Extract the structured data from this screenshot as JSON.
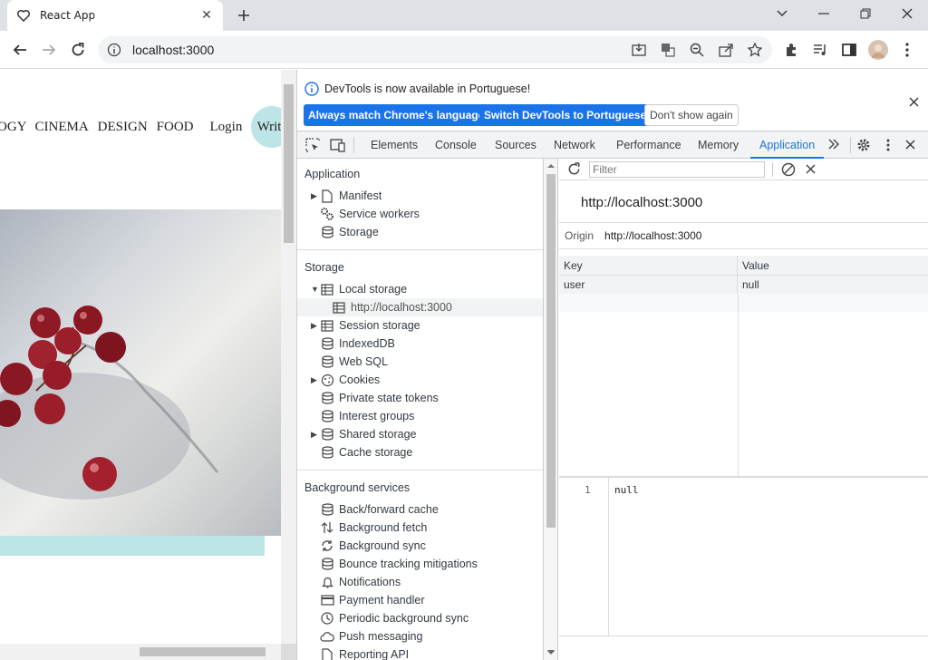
{
  "browser": {
    "tab_title": "React App",
    "url": "localhost:3000"
  },
  "page": {
    "nav_items": [
      "OGY",
      "CINEMA",
      "DESIGN",
      "FOOD"
    ],
    "login": "Login",
    "write": "Write",
    "accent_color": "#bde4e6"
  },
  "devtools": {
    "info_message": "DevTools is now available in Portuguese!",
    "btn_match": "Always match Chrome's language",
    "btn_switch": "Switch DevTools to Portuguese",
    "btn_dont_show": "Don't show again",
    "tabs": [
      "Elements",
      "Console",
      "Sources",
      "Network",
      "Performance",
      "Memory",
      "Application"
    ],
    "active_tab": "Application",
    "sidebar": {
      "application_header": "Application",
      "application_items": [
        "Manifest",
        "Service workers",
        "Storage"
      ],
      "storage_header": "Storage",
      "local_storage": "Local storage",
      "local_storage_child": "http://localhost:3000",
      "storage_items": [
        "Session storage",
        "IndexedDB",
        "Web SQL",
        "Cookies",
        "Private state tokens",
        "Interest groups",
        "Shared storage",
        "Cache storage"
      ],
      "background_header": "Background services",
      "background_items": [
        "Back/forward cache",
        "Background fetch",
        "Background sync",
        "Bounce tracking mitigations",
        "Notifications",
        "Payment handler",
        "Periodic background sync",
        "Push messaging",
        "Reporting API"
      ]
    },
    "main": {
      "filter_placeholder": "Filter",
      "origin_title": "http://localhost:3000",
      "origin_label": "Origin",
      "origin_value": "http://localhost:3000",
      "col_key": "Key",
      "col_value": "Value",
      "rows": [
        {
          "key": "user",
          "value": "null"
        }
      ],
      "editor_line": "1",
      "editor_text": "null"
    }
  }
}
